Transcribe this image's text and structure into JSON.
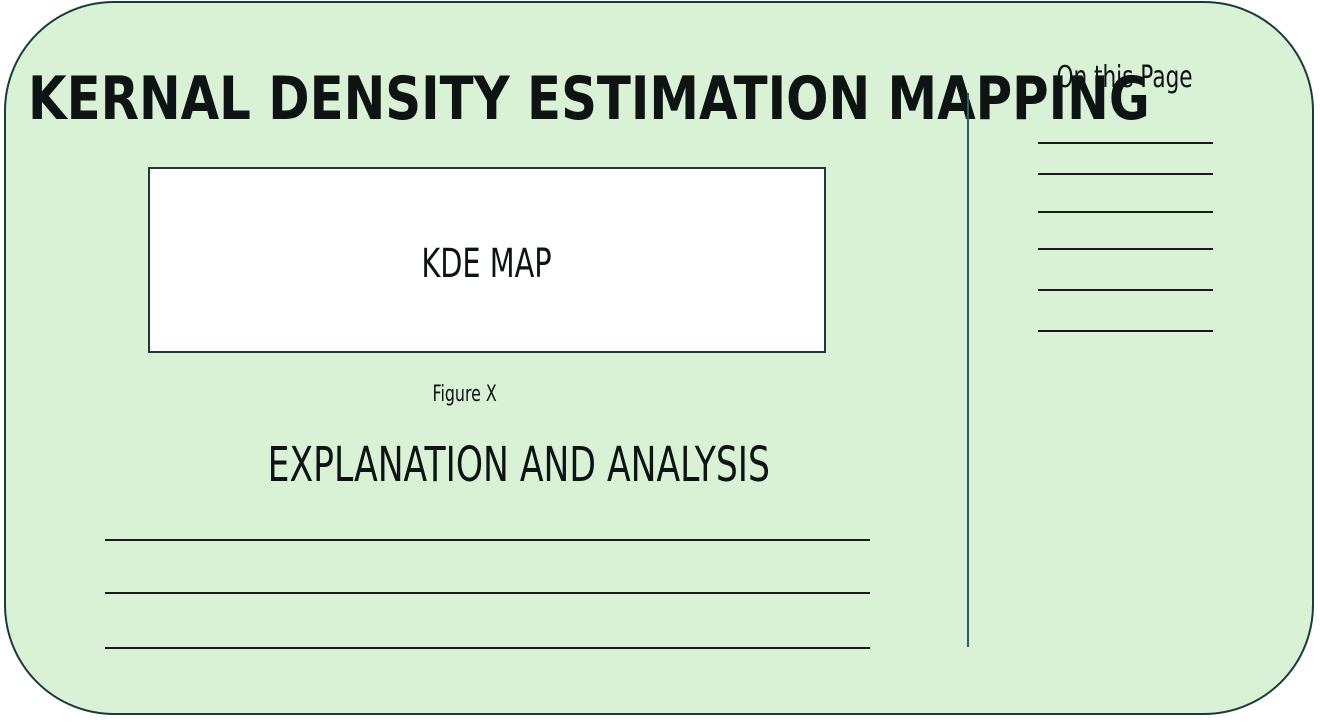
{
  "page": {
    "title": "KERNAL DENSITY ESTIMATION MAPPING",
    "background_color": "#d9f1d4",
    "border_color": "#1c3a3a"
  },
  "figure": {
    "placeholder_label": "KDE MAP",
    "caption": "Figure X"
  },
  "explanation": {
    "heading": "EXPLANATION AND ANALYSIS",
    "text_lines": [
      "",
      "",
      ""
    ]
  },
  "sidebar": {
    "heading": "On this Page",
    "entries": [
      "",
      "",
      "",
      "",
      "",
      ""
    ]
  }
}
